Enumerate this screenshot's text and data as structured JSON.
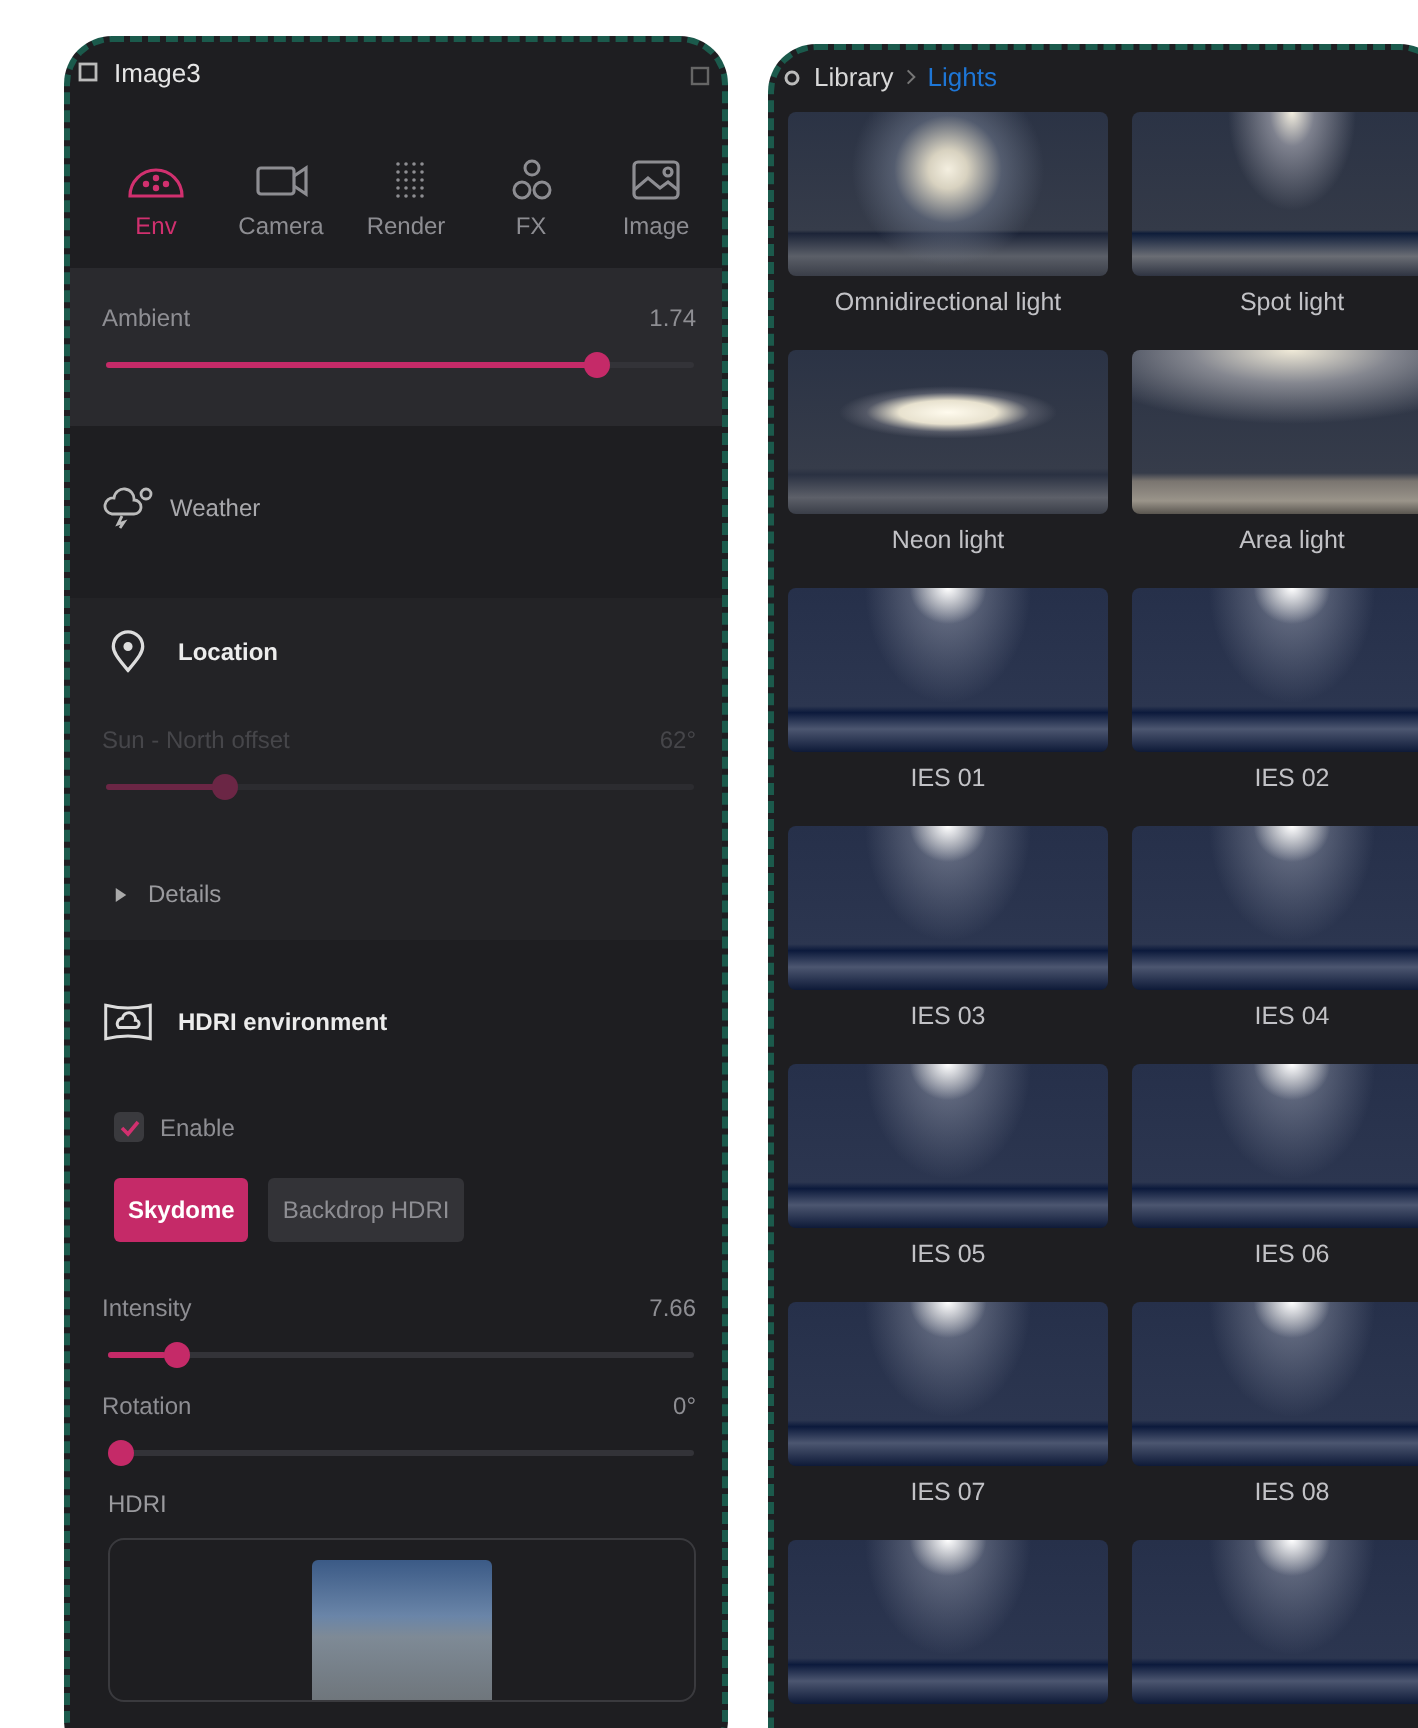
{
  "inspector": {
    "title": "Image3",
    "tabs": [
      {
        "label": "Env",
        "selected": true
      },
      {
        "label": "Camera",
        "selected": false
      },
      {
        "label": "Render",
        "selected": false
      },
      {
        "label": "FX",
        "selected": false
      },
      {
        "label": "Image",
        "selected": false
      }
    ],
    "ambient": {
      "label": "Ambient",
      "reading": "1.74",
      "level": 0.85
    },
    "weather": {
      "label": "Weather"
    },
    "location": {
      "title": "Location",
      "slider": {
        "label": "Sun - North offset",
        "reading": "62°",
        "level": 0.19,
        "disabled": true
      },
      "details": {
        "label": "Details",
        "expanded": false
      }
    },
    "hdri": {
      "title": "HDRI environment",
      "enable": {
        "label": "Enable",
        "checked": true
      },
      "modes": [
        {
          "label": "Skydome",
          "selected": true
        },
        {
          "label": "Backdrop HDRI",
          "selected": false
        }
      ],
      "sliders": [
        {
          "label": "Intensity",
          "reading": "7.66",
          "level": 0.1,
          "disabled": false
        },
        {
          "label": "Rotation",
          "reading": "0°",
          "level": 0,
          "disabled": false
        }
      ],
      "picker_label": "HDRI"
    }
  },
  "library": {
    "breadcrumb": [
      {
        "label": "Library",
        "selected": false
      },
      {
        "label": "Lights",
        "selected": true
      }
    ],
    "items": [
      {
        "label": "Omnidirectional light",
        "kind": "omni"
      },
      {
        "label": "Spot light",
        "kind": "spot"
      },
      {
        "label": "Neon light",
        "kind": "neon"
      },
      {
        "label": "Area light",
        "kind": "area"
      },
      {
        "label": "IES 01",
        "kind": "ies"
      },
      {
        "label": "IES 02",
        "kind": "ies"
      },
      {
        "label": "IES 03",
        "kind": "ies"
      },
      {
        "label": "IES 04",
        "kind": "ies"
      },
      {
        "label": "IES 05",
        "kind": "ies"
      },
      {
        "label": "IES 06",
        "kind": "ies"
      },
      {
        "label": "IES 07",
        "kind": "ies"
      },
      {
        "label": "IES 08",
        "kind": "ies"
      },
      {
        "kind": "ies"
      },
      {
        "kind": "ies"
      }
    ]
  }
}
